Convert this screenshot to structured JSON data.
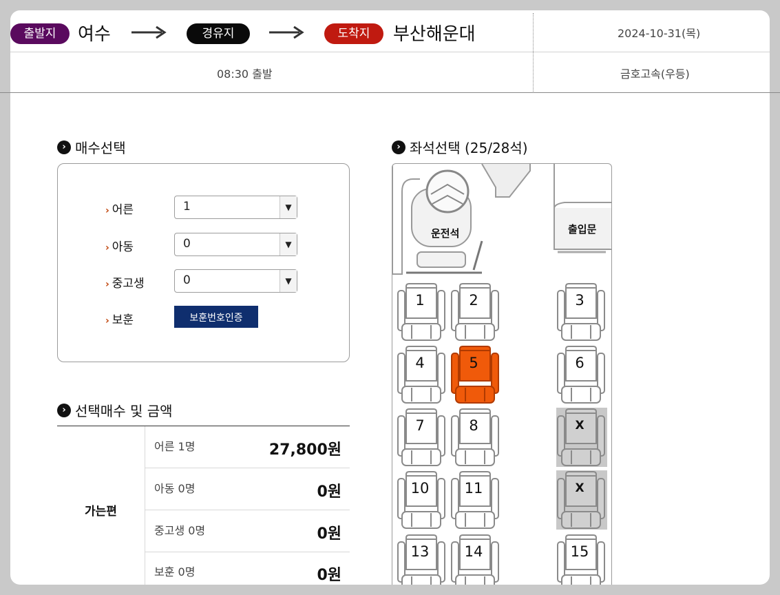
{
  "route": {
    "departure_badge": "출발지",
    "departure": "여수",
    "via_badge": "경유지",
    "arrival_badge": "도착지",
    "arrival": "부산해운대",
    "date": "2024-10-31(목)",
    "departure_time": "08:30 출발",
    "bus_company": "금호고속(우등)"
  },
  "ticket_select": {
    "title": "매수선택",
    "rows": [
      {
        "label": "어른",
        "value": "1"
      },
      {
        "label": "아동",
        "value": "0"
      },
      {
        "label": "중고생",
        "value": "0"
      }
    ],
    "veteran_label": "보훈",
    "verify_button": "보훈번호인증"
  },
  "summary": {
    "title": "선택매수 및 금액",
    "trip_label": "가는편",
    "rows": [
      {
        "label": "어른 1명",
        "amount": "27,800원"
      },
      {
        "label": "아동 0명",
        "amount": "0원"
      },
      {
        "label": "중고생 0명",
        "amount": "0원"
      },
      {
        "label": "보훈 0명",
        "amount": "0원"
      }
    ]
  },
  "seat_select": {
    "title": "좌석선택 (25/28석)",
    "driver_label": "운전석",
    "door_label": "출입문",
    "seats": [
      {
        "label": "1",
        "status": "available"
      },
      {
        "label": "2",
        "status": "available"
      },
      {
        "label": "3",
        "status": "available"
      },
      {
        "label": "4",
        "status": "available"
      },
      {
        "label": "5",
        "status": "selected"
      },
      {
        "label": "6",
        "status": "available"
      },
      {
        "label": "7",
        "status": "available"
      },
      {
        "label": "8",
        "status": "available"
      },
      {
        "label": "X",
        "status": "taken"
      },
      {
        "label": "10",
        "status": "available"
      },
      {
        "label": "11",
        "status": "available"
      },
      {
        "label": "X",
        "status": "taken"
      },
      {
        "label": "13",
        "status": "available"
      },
      {
        "label": "14",
        "status": "available"
      },
      {
        "label": "15",
        "status": "available"
      }
    ]
  },
  "colors": {
    "departure_badge": "#5a0a5e",
    "via_badge": "#0a0a0a",
    "arrival_badge": "#c01a10",
    "selected_seat": "#f05a0a",
    "taken_seat": "#c8c8c8",
    "verify_button": "#0f2e6e"
  }
}
